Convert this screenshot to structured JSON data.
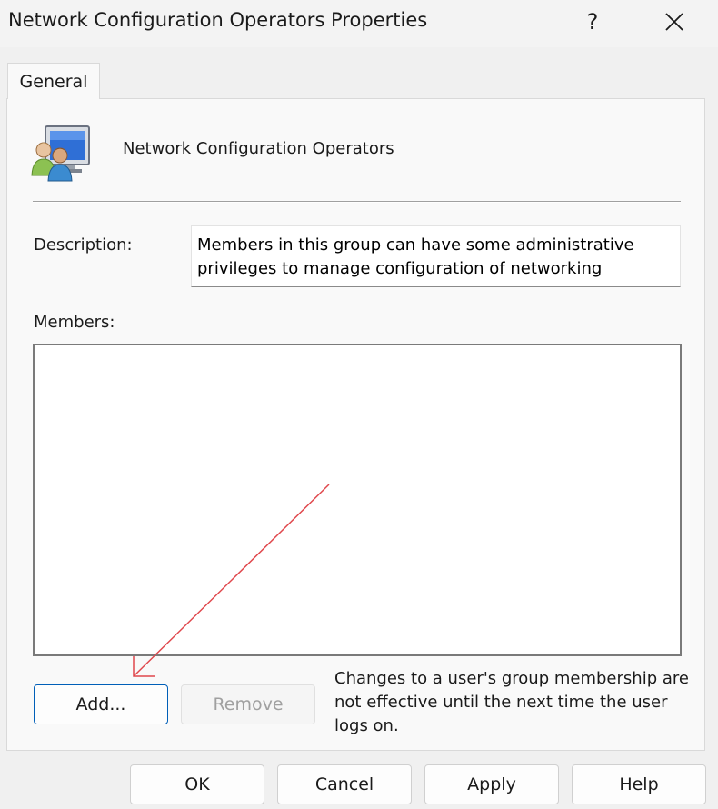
{
  "window": {
    "title": "Network Configuration Operators Properties",
    "help_glyph": "?",
    "close_glyph": "✕"
  },
  "tabs": [
    {
      "label": "General",
      "selected": true
    }
  ],
  "group": {
    "icon": "user-group-icon",
    "name": "Network Configuration Operators"
  },
  "description": {
    "label": "Description:",
    "value": "Members in this group can have some administrative privileges to manage configuration of networking"
  },
  "members": {
    "label": "Members:",
    "items": []
  },
  "buttons": {
    "add": "Add...",
    "remove": "Remove",
    "ok": "OK",
    "cancel": "Cancel",
    "apply": "Apply",
    "help": "Help"
  },
  "note": "Changes to a user's group membership are not effective until the next time the user logs on.",
  "annotation": {
    "type": "arrow",
    "color": "#e0474c",
    "points_to": "add-button"
  }
}
